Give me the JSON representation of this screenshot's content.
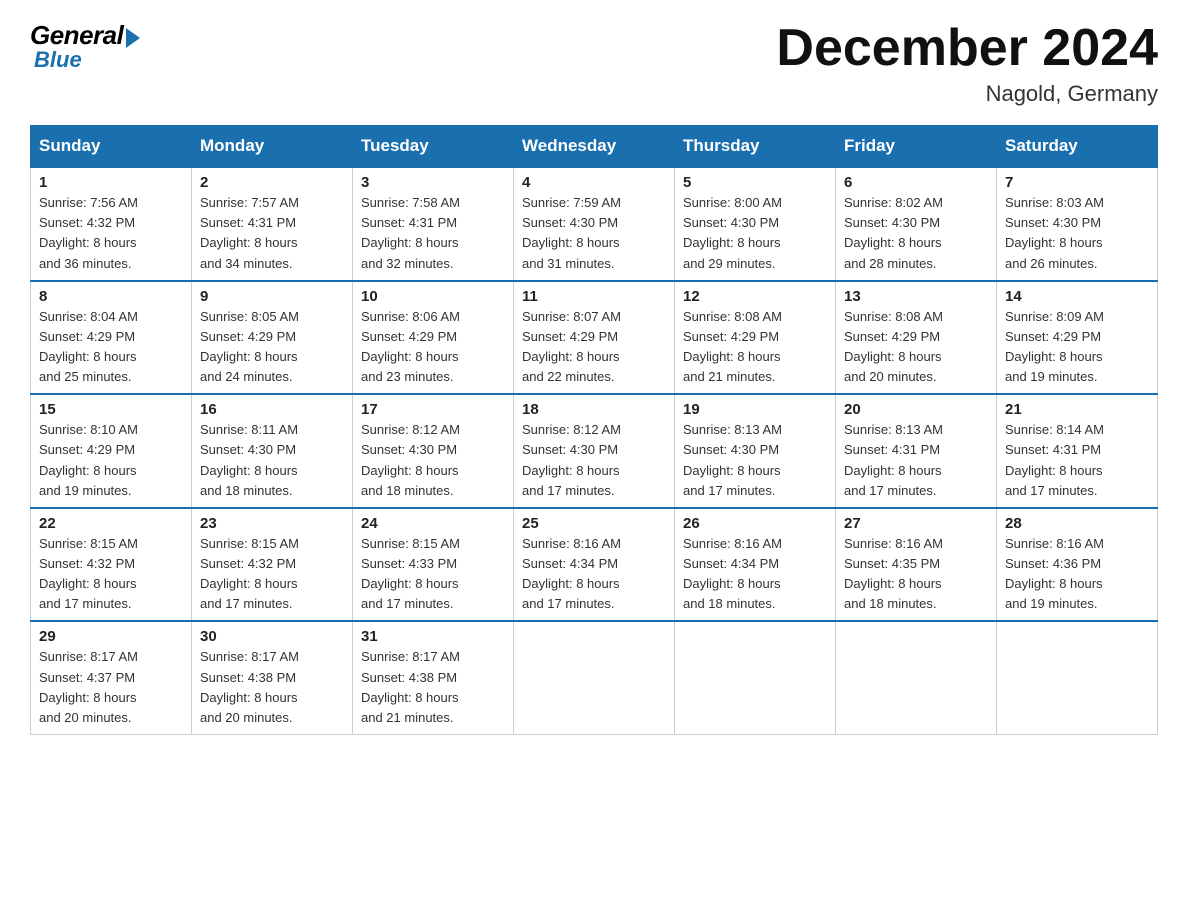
{
  "header": {
    "logo_general": "General",
    "logo_blue": "Blue",
    "month_title": "December 2024",
    "location": "Nagold, Germany"
  },
  "days_of_week": [
    "Sunday",
    "Monday",
    "Tuesday",
    "Wednesday",
    "Thursday",
    "Friday",
    "Saturday"
  ],
  "weeks": [
    [
      {
        "day": "1",
        "sunrise": "7:56 AM",
        "sunset": "4:32 PM",
        "daylight": "8 hours and 36 minutes."
      },
      {
        "day": "2",
        "sunrise": "7:57 AM",
        "sunset": "4:31 PM",
        "daylight": "8 hours and 34 minutes."
      },
      {
        "day": "3",
        "sunrise": "7:58 AM",
        "sunset": "4:31 PM",
        "daylight": "8 hours and 32 minutes."
      },
      {
        "day": "4",
        "sunrise": "7:59 AM",
        "sunset": "4:30 PM",
        "daylight": "8 hours and 31 minutes."
      },
      {
        "day": "5",
        "sunrise": "8:00 AM",
        "sunset": "4:30 PM",
        "daylight": "8 hours and 29 minutes."
      },
      {
        "day": "6",
        "sunrise": "8:02 AM",
        "sunset": "4:30 PM",
        "daylight": "8 hours and 28 minutes."
      },
      {
        "day": "7",
        "sunrise": "8:03 AM",
        "sunset": "4:30 PM",
        "daylight": "8 hours and 26 minutes."
      }
    ],
    [
      {
        "day": "8",
        "sunrise": "8:04 AM",
        "sunset": "4:29 PM",
        "daylight": "8 hours and 25 minutes."
      },
      {
        "day": "9",
        "sunrise": "8:05 AM",
        "sunset": "4:29 PM",
        "daylight": "8 hours and 24 minutes."
      },
      {
        "day": "10",
        "sunrise": "8:06 AM",
        "sunset": "4:29 PM",
        "daylight": "8 hours and 23 minutes."
      },
      {
        "day": "11",
        "sunrise": "8:07 AM",
        "sunset": "4:29 PM",
        "daylight": "8 hours and 22 minutes."
      },
      {
        "day": "12",
        "sunrise": "8:08 AM",
        "sunset": "4:29 PM",
        "daylight": "8 hours and 21 minutes."
      },
      {
        "day": "13",
        "sunrise": "8:08 AM",
        "sunset": "4:29 PM",
        "daylight": "8 hours and 20 minutes."
      },
      {
        "day": "14",
        "sunrise": "8:09 AM",
        "sunset": "4:29 PM",
        "daylight": "8 hours and 19 minutes."
      }
    ],
    [
      {
        "day": "15",
        "sunrise": "8:10 AM",
        "sunset": "4:29 PM",
        "daylight": "8 hours and 19 minutes."
      },
      {
        "day": "16",
        "sunrise": "8:11 AM",
        "sunset": "4:30 PM",
        "daylight": "8 hours and 18 minutes."
      },
      {
        "day": "17",
        "sunrise": "8:12 AM",
        "sunset": "4:30 PM",
        "daylight": "8 hours and 18 minutes."
      },
      {
        "day": "18",
        "sunrise": "8:12 AM",
        "sunset": "4:30 PM",
        "daylight": "8 hours and 17 minutes."
      },
      {
        "day": "19",
        "sunrise": "8:13 AM",
        "sunset": "4:30 PM",
        "daylight": "8 hours and 17 minutes."
      },
      {
        "day": "20",
        "sunrise": "8:13 AM",
        "sunset": "4:31 PM",
        "daylight": "8 hours and 17 minutes."
      },
      {
        "day": "21",
        "sunrise": "8:14 AM",
        "sunset": "4:31 PM",
        "daylight": "8 hours and 17 minutes."
      }
    ],
    [
      {
        "day": "22",
        "sunrise": "8:15 AM",
        "sunset": "4:32 PM",
        "daylight": "8 hours and 17 minutes."
      },
      {
        "day": "23",
        "sunrise": "8:15 AM",
        "sunset": "4:32 PM",
        "daylight": "8 hours and 17 minutes."
      },
      {
        "day": "24",
        "sunrise": "8:15 AM",
        "sunset": "4:33 PM",
        "daylight": "8 hours and 17 minutes."
      },
      {
        "day": "25",
        "sunrise": "8:16 AM",
        "sunset": "4:34 PM",
        "daylight": "8 hours and 17 minutes."
      },
      {
        "day": "26",
        "sunrise": "8:16 AM",
        "sunset": "4:34 PM",
        "daylight": "8 hours and 18 minutes."
      },
      {
        "day": "27",
        "sunrise": "8:16 AM",
        "sunset": "4:35 PM",
        "daylight": "8 hours and 18 minutes."
      },
      {
        "day": "28",
        "sunrise": "8:16 AM",
        "sunset": "4:36 PM",
        "daylight": "8 hours and 19 minutes."
      }
    ],
    [
      {
        "day": "29",
        "sunrise": "8:17 AM",
        "sunset": "4:37 PM",
        "daylight": "8 hours and 20 minutes."
      },
      {
        "day": "30",
        "sunrise": "8:17 AM",
        "sunset": "4:38 PM",
        "daylight": "8 hours and 20 minutes."
      },
      {
        "day": "31",
        "sunrise": "8:17 AM",
        "sunset": "4:38 PM",
        "daylight": "8 hours and 21 minutes."
      },
      null,
      null,
      null,
      null
    ]
  ],
  "labels": {
    "sunrise": "Sunrise:",
    "sunset": "Sunset:",
    "daylight": "Daylight:"
  }
}
